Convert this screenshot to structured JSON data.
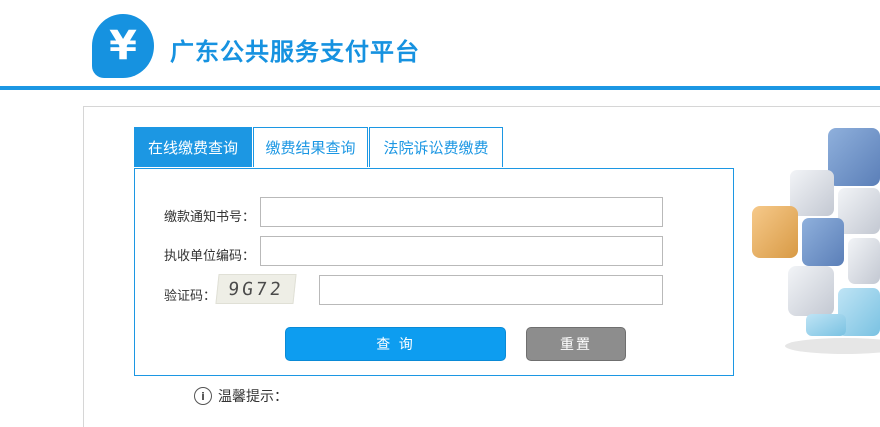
{
  "header": {
    "logo_glyph": "¥",
    "title": "广东公共服务支付平台",
    "accent_color": "#1c97e3"
  },
  "tabs": [
    {
      "label": "在线缴费查询",
      "active": true
    },
    {
      "label": "缴费结果查询",
      "active": false
    },
    {
      "label": "法院诉讼费缴费",
      "active": false
    }
  ],
  "form": {
    "notice_no_label": "缴款通知书号：",
    "notice_no_value": "",
    "unit_code_label": "执收单位编码：",
    "unit_code_value": "",
    "captcha_label": "验证码：",
    "captcha_text": "9G72",
    "captcha_value": ""
  },
  "buttons": {
    "query_label": "查 询",
    "reset_label": "重置"
  },
  "tips": {
    "icon": "info-icon",
    "label": "温馨提示："
  },
  "decoration": {
    "image": "rubik-cube-illustration"
  }
}
